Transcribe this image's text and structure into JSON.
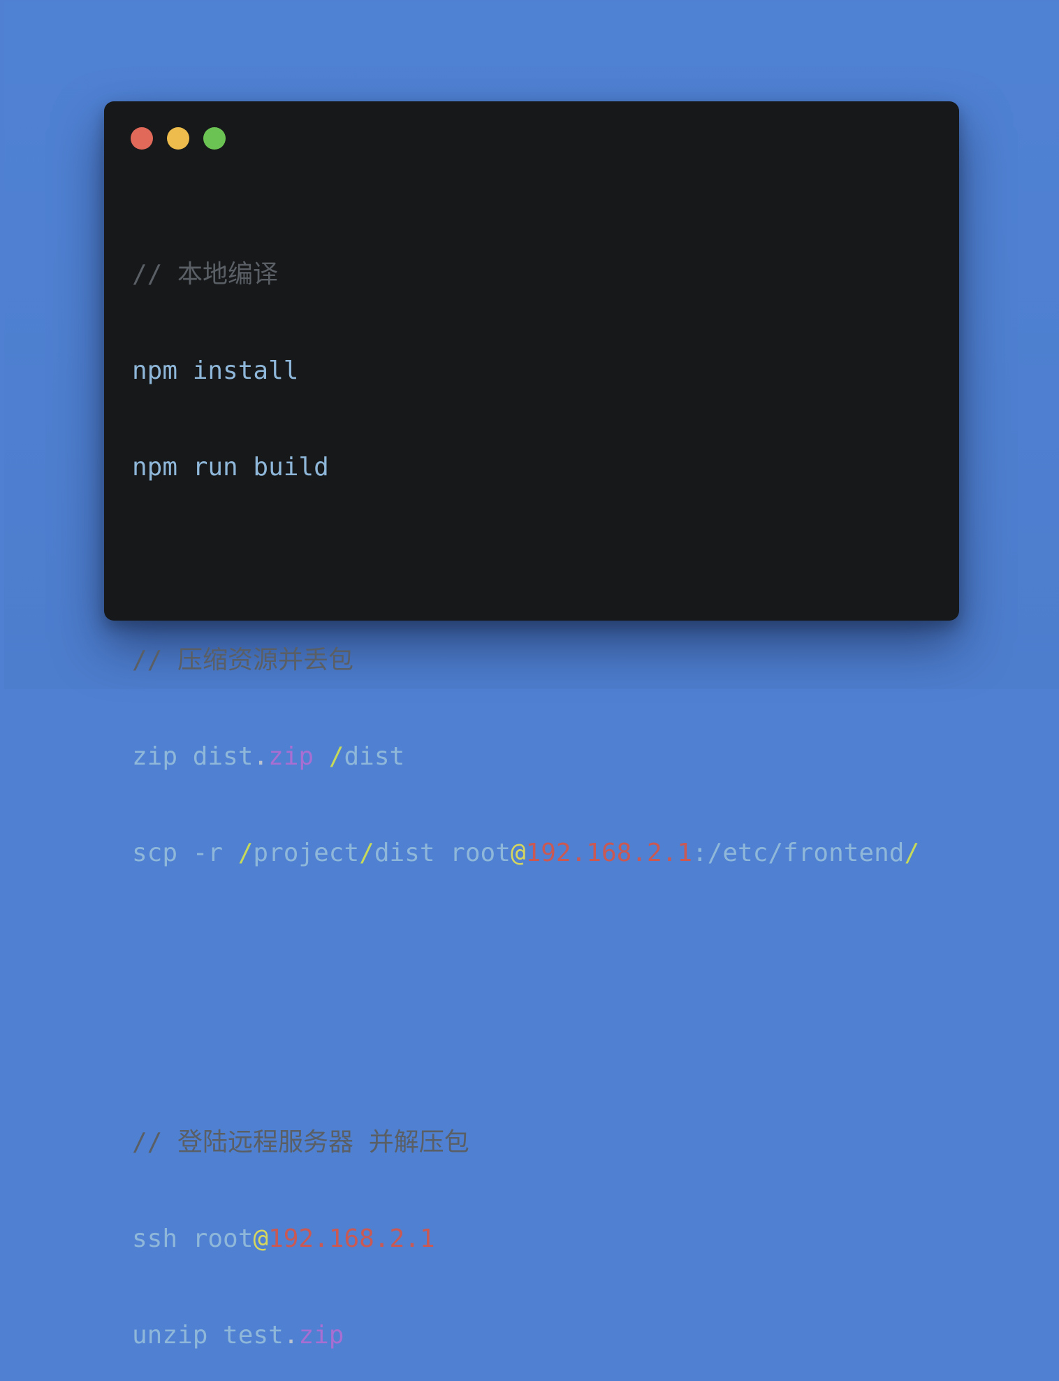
{
  "colors": {
    "background": "#4f80d2",
    "window_background": "#17181a",
    "close": "#e0695a",
    "minimize": "#edbc4c",
    "maximize": "#6bc353",
    "comment": "#5a5f66",
    "plain": "#8fb7d9",
    "member": "#a86ed1",
    "slash": "#c6d95a",
    "at_sign": "#d7d75e",
    "ip": "#c95952"
  },
  "window": {
    "controls": {
      "close_icon": "close-circle-icon",
      "minimize_icon": "minimize-circle-icon",
      "maximize_icon": "maximize-circle-icon"
    }
  },
  "code": {
    "comment_local_build": "// 本地编译",
    "npm_install": "npm install",
    "npm_run_build": "npm run build",
    "comment_zip_upload": "// 压缩资源并丢包",
    "zip_cmd": "zip dist",
    "zip_dot": ".",
    "zip_ext": "zip",
    "zip_space": " ",
    "zip_slash": "/",
    "zip_target": "dist",
    "scp_cmd": "scp -r ",
    "scp_slash1": "/",
    "scp_project": "project",
    "scp_slash2": "/",
    "scp_dist_root": "dist root",
    "scp_at": "@",
    "scp_ip": "192.168.2.1",
    "scp_path": ":/etc/frontend",
    "scp_slash3": "/",
    "comment_login_unzip": "// 登陆远程服务器 并解压包",
    "ssh_cmd": "ssh root",
    "ssh_at": "@",
    "ssh_ip": "192.168.2.1",
    "unzip_cmd": "unzip test",
    "unzip_dot": ".",
    "unzip_ext": "zip"
  }
}
